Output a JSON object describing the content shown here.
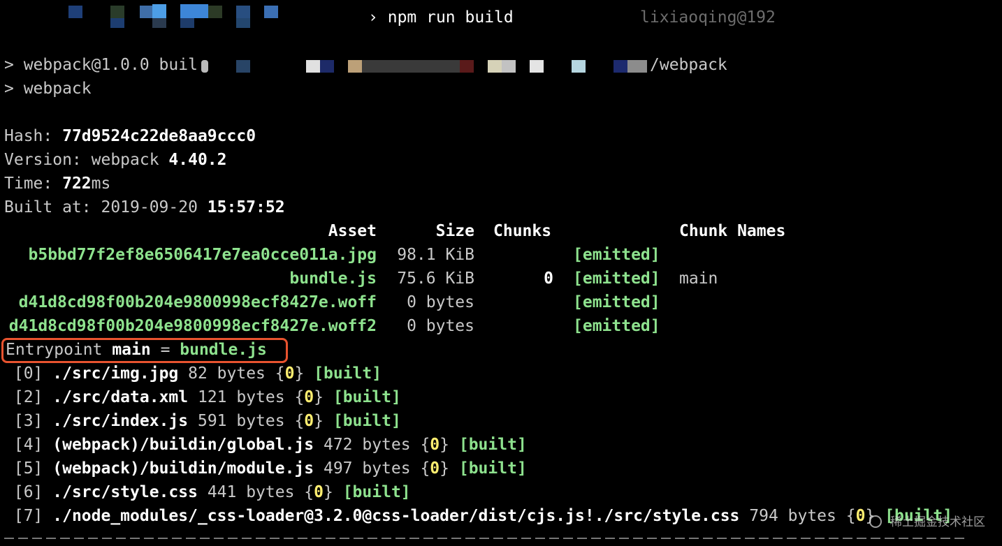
{
  "prompt": {
    "arrow": "›",
    "command": "npm run build",
    "user_host": "lixiaoqing@192"
  },
  "npm_script": {
    "line1_prefix": "> webpack@1.0.0 buil",
    "line1_suffix": "/webpack",
    "line2": "> webpack"
  },
  "stats": {
    "hash_label": "Hash: ",
    "hash_value": "77d9524c22de8aa9ccc0",
    "version_label": "Version: webpack ",
    "version_value": "4.40.2",
    "time_label": "Time: ",
    "time_value": "722",
    "time_unit": "ms",
    "built_label": "Built at: 2019-09-20 ",
    "built_value": "15:57:52"
  },
  "assets_table": {
    "headers": {
      "asset": "Asset",
      "size": "Size",
      "chunks": "Chunks",
      "chunk_names": "Chunk Names"
    },
    "rows": [
      {
        "asset": "b5bbd77f2ef8e6506417e7ea0cce011a.jpg",
        "size": "98.1 KiB",
        "chunks": "",
        "status": "[emitted]",
        "chunk_names": ""
      },
      {
        "asset": "bundle.js",
        "size": "75.6 KiB",
        "chunks": "0",
        "status": "[emitted]",
        "chunk_names": "main"
      },
      {
        "asset": "d41d8cd98f00b204e9800998ecf8427e.woff",
        "size": "0 bytes",
        "chunks": "",
        "status": "[emitted]",
        "chunk_names": ""
      },
      {
        "asset": "d41d8cd98f00b204e9800998ecf8427e.woff2",
        "size": "0 bytes",
        "chunks": "",
        "status": "[emitted]",
        "chunk_names": ""
      }
    ]
  },
  "entrypoint": {
    "label": "Entrypoint ",
    "name": "main",
    "eq": " = ",
    "file": "bundle.js"
  },
  "modules": [
    {
      "id": " [0] ",
      "path": "./src/img.jpg",
      "size": " 82 bytes {",
      "chunk": "0",
      "close": "} ",
      "status": "[built]"
    },
    {
      "id": " [2] ",
      "path": "./src/data.xml",
      "size": " 121 bytes {",
      "chunk": "0",
      "close": "} ",
      "status": "[built]"
    },
    {
      "id": " [3] ",
      "path": "./src/index.js",
      "size": " 591 bytes {",
      "chunk": "0",
      "close": "} ",
      "status": "[built]"
    },
    {
      "id": " [4] ",
      "path": "(webpack)/buildin/global.js",
      "size": " 472 bytes {",
      "chunk": "0",
      "close": "} ",
      "status": "[built]"
    },
    {
      "id": " [5] ",
      "path": "(webpack)/buildin/module.js",
      "size": " 497 bytes {",
      "chunk": "0",
      "close": "} ",
      "status": "[built]"
    },
    {
      "id": " [6] ",
      "path": "./src/style.css",
      "size": " 441 bytes {",
      "chunk": "0",
      "close": "} ",
      "status": "[built]"
    },
    {
      "id": " [7] ",
      "path": "./node_modules/_css-loader@3.2.0@css-loader/dist/cjs.js!./src/style.css",
      "size": " 794 bytes {",
      "chunk": "0",
      "close": "} ",
      "status": "[built]"
    }
  ],
  "watermark": {
    "text": "稀土掘金技术社区"
  },
  "colors": {
    "background": "#000000",
    "text": "#c9c9c9",
    "bright": "#ffffff",
    "green": "#8ee28e",
    "yellow": "#ffee70",
    "highlight_border": "#e8532f"
  }
}
